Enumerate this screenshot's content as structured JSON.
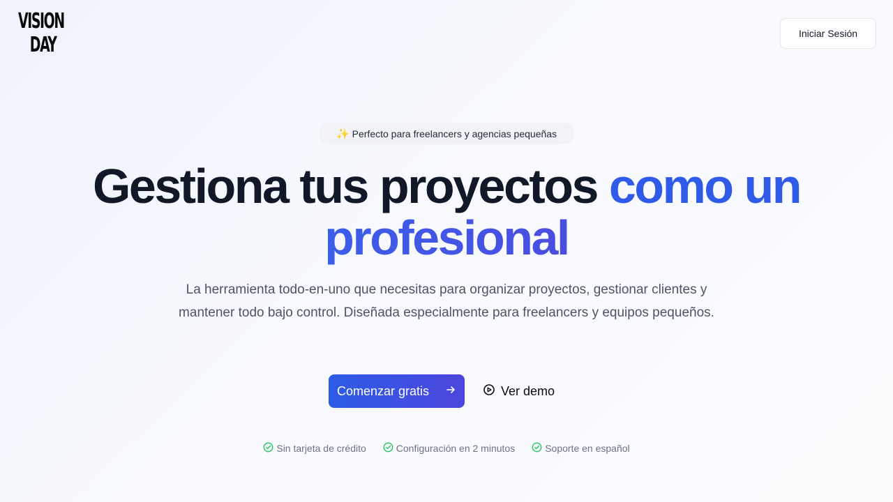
{
  "brand": {
    "line1": "VISION",
    "line2": "DAY"
  },
  "header": {
    "login_label": "Iniciar Sesión"
  },
  "hero": {
    "badge_icon": "✨",
    "badge_text": "Perfecto para freelancers y agencias pequeñas",
    "headline_part1": "Gestiona tus proyectos ",
    "headline_part2": "como un",
    "headline_part3": "profesional",
    "subtitle": "La herramienta todo-en-uno que necesitas para organizar proyectos, gestionar clientes y mantener todo bajo control. Diseñada especialmente para freelancers y equipos pequeños.",
    "cta_primary_label": "Comenzar gratis",
    "cta_secondary_label": "Ver demo"
  },
  "features": [
    {
      "label": "Sin tarjeta de crédito",
      "icon": "check-circle-icon"
    },
    {
      "label": "Configuración en 2 minutos",
      "icon": "check-circle-icon"
    },
    {
      "label": "Soporte en español",
      "icon": "check-circle-icon"
    }
  ],
  "colors": {
    "accent_blue": "#2f5be8",
    "accent_indigo": "#4c45dd",
    "check_green": "#22c55e",
    "text_dark": "#111827",
    "text_muted": "#6b7280"
  }
}
